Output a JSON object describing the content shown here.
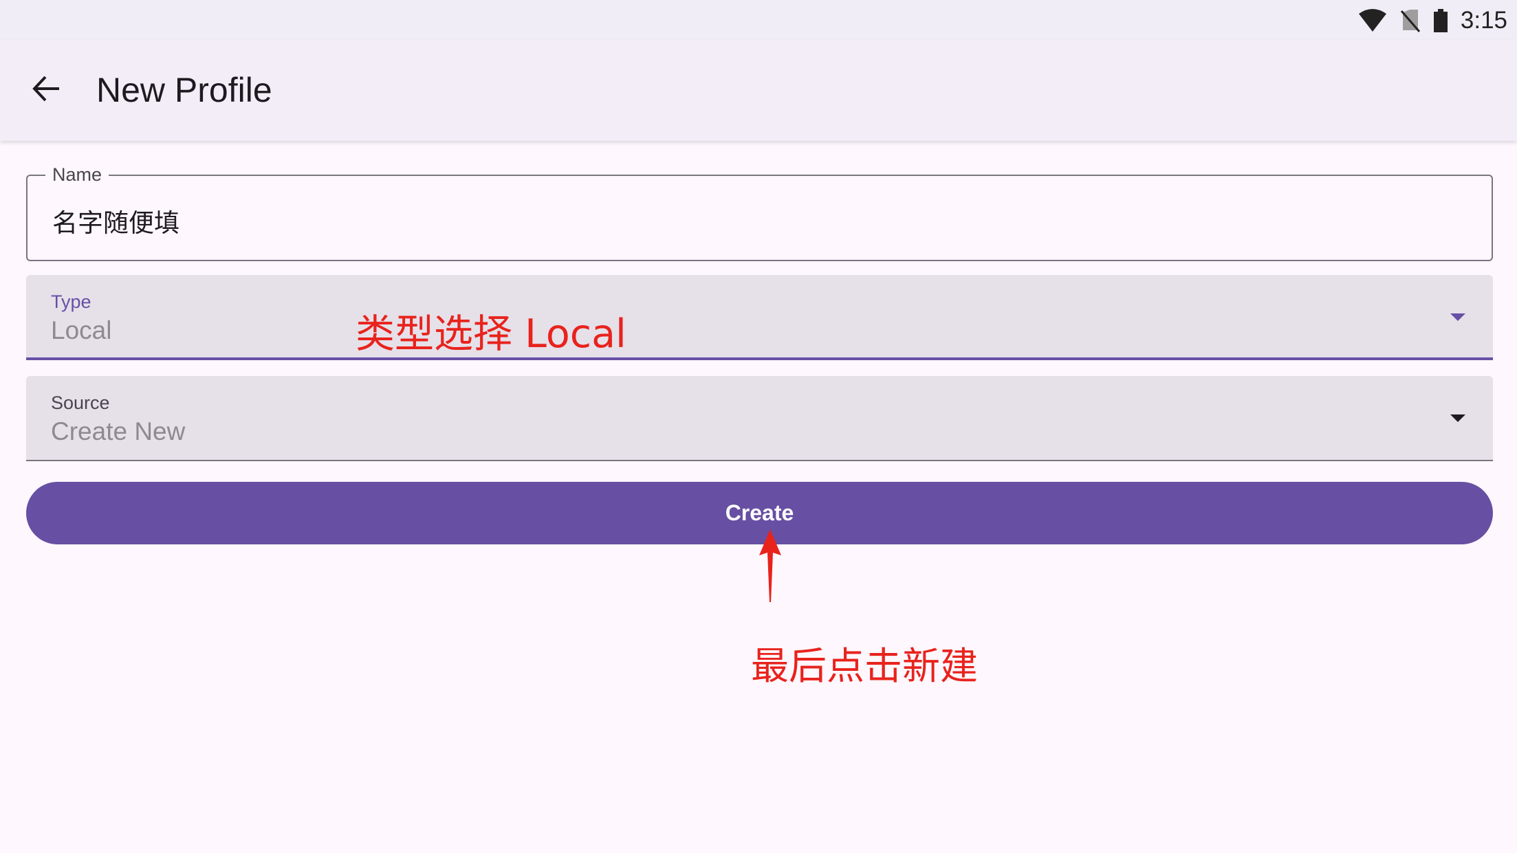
{
  "status_bar": {
    "time": "3:15",
    "icons": [
      "wifi-icon",
      "no-sim-icon",
      "battery-icon"
    ]
  },
  "app_bar": {
    "back_icon": "arrow-back-icon",
    "title": "New Profile"
  },
  "form": {
    "name": {
      "label": "Name",
      "value": "名字随便填"
    },
    "type": {
      "label": "Type",
      "value": "Local"
    },
    "source": {
      "label": "Source",
      "value": "Create New"
    },
    "create_button": "Create"
  },
  "annotations": {
    "type_hint": "类型选择 Local",
    "create_hint": "最后点击新建"
  },
  "colors": {
    "primary": "#674fa3",
    "annotation": "#e8231c",
    "field_fill": "#e6e0e9",
    "background": "#fef7fe"
  }
}
